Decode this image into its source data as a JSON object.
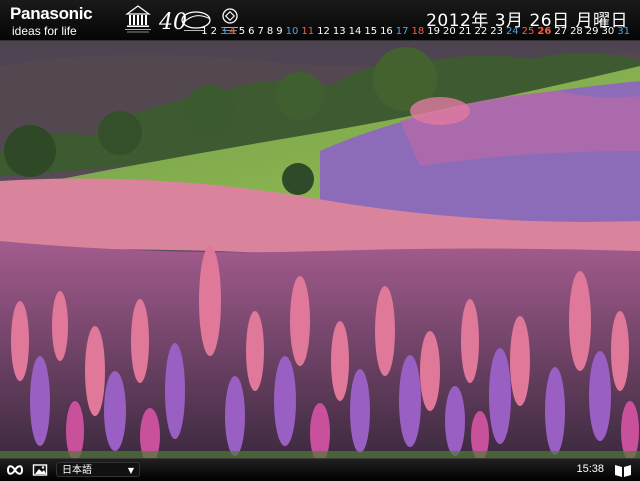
{
  "header": {
    "brand_name": "Panasonic",
    "brand_tagline": "ideas for life",
    "date_text": "2012年 3月 26日 月曜日",
    "days": [
      {
        "n": "1",
        "k": "weekday"
      },
      {
        "n": "2",
        "k": "weekday"
      },
      {
        "n": "3",
        "k": "sat"
      },
      {
        "n": "4",
        "k": "sun"
      },
      {
        "n": "5",
        "k": "weekday"
      },
      {
        "n": "6",
        "k": "weekday"
      },
      {
        "n": "7",
        "k": "weekday"
      },
      {
        "n": "8",
        "k": "weekday"
      },
      {
        "n": "9",
        "k": "weekday"
      },
      {
        "n": "10",
        "k": "sat"
      },
      {
        "n": "11",
        "k": "sun"
      },
      {
        "n": "12",
        "k": "weekday"
      },
      {
        "n": "13",
        "k": "weekday"
      },
      {
        "n": "14",
        "k": "weekday"
      },
      {
        "n": "15",
        "k": "weekday"
      },
      {
        "n": "16",
        "k": "weekday"
      },
      {
        "n": "17",
        "k": "sat"
      },
      {
        "n": "18",
        "k": "sun"
      },
      {
        "n": "19",
        "k": "weekday"
      },
      {
        "n": "20",
        "k": "weekday"
      },
      {
        "n": "21",
        "k": "weekday"
      },
      {
        "n": "22",
        "k": "weekday"
      },
      {
        "n": "23",
        "k": "weekday"
      },
      {
        "n": "24",
        "k": "sat"
      },
      {
        "n": "25",
        "k": "sun"
      },
      {
        "n": "26",
        "k": "today"
      },
      {
        "n": "27",
        "k": "weekday"
      },
      {
        "n": "28",
        "k": "weekday"
      },
      {
        "n": "29",
        "k": "weekday"
      },
      {
        "n": "30",
        "k": "weekday"
      },
      {
        "n": "31",
        "k": "sat"
      }
    ],
    "logos": [
      "unesco-logo",
      "40-years-anniversary-logo",
      "world-heritage-emblem"
    ]
  },
  "photo": {
    "subject": "lupine-meadow-photo",
    "colors": {
      "sky_haze": "#5b4f5d",
      "hill": "#4e6a3b",
      "grass": "#7fb04a",
      "pink": "#e07a9a",
      "purple": "#8a6cc8",
      "magenta": "#c74a90"
    }
  },
  "footer": {
    "language_value": "日本語",
    "clock": "15:38",
    "icons": [
      "infinity-icon",
      "photo-icon",
      "caret-down-icon",
      "book-icon"
    ]
  }
}
